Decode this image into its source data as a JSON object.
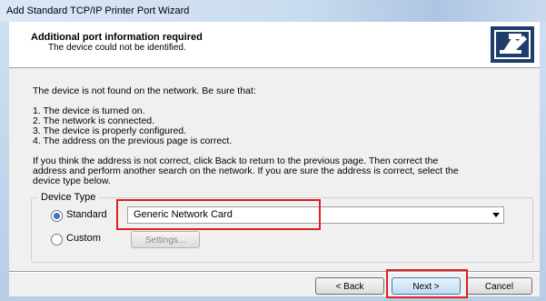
{
  "window": {
    "title": "Add Standard TCP/IP Printer Port Wizard"
  },
  "header": {
    "title": "Additional port information required",
    "subtitle": "The device could not be identified.",
    "icon": "printer-port-icon"
  },
  "body": {
    "intro": "The device is not found on the network.  Be sure that:",
    "checklist": [
      "1.  The device is turned on.",
      "2.  The network is connected.",
      "3.  The device is properly configured.",
      "4.  The address on the previous page is correct."
    ],
    "paragraph": [
      "If you think the address is not correct, click Back to return to the previous page.  Then correct the",
      "address and perform another search on the network.  If you are sure the address is correct, select the",
      "device type below."
    ]
  },
  "device_type": {
    "legend": "Device Type",
    "standard_label": "Standard",
    "custom_label": "Custom",
    "selected": "Standard",
    "select_value": "Generic Network Card",
    "settings_label": "Settings..."
  },
  "buttons": {
    "back": "< Back",
    "next": "Next >",
    "cancel": "Cancel"
  },
  "highlight_color": "#e02020"
}
